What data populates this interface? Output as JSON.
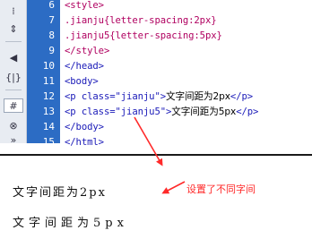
{
  "toolbar": {
    "icons": [
      "format-icon",
      "collapse-icon",
      "select-tag-icon",
      "braces-icon",
      "hash-icon",
      "comment-icon",
      "more-icon"
    ],
    "glyphs": [
      "⁞",
      "⇕",
      "◀",
      "{|}",
      "#",
      "⊗",
      "»"
    ]
  },
  "code_lines": [
    {
      "num": "6",
      "text": "<style>"
    },
    {
      "num": "7",
      "text": ".jianju{letter-spacing:2px}"
    },
    {
      "num": "8",
      "text": ".jianju5{letter-spacing:5px}"
    },
    {
      "num": "9",
      "text": "</style>"
    },
    {
      "num": "10",
      "text": "</head>"
    },
    {
      "num": "11",
      "text": "<body>"
    },
    {
      "num": "12",
      "text_a": "<p class=\"jianju\">",
      "text_b": "文字间距为2px",
      "text_c": "</p>"
    },
    {
      "num": "13",
      "text_a": "<p class=\"jianju5\">",
      "text_b": "文字间距为5px",
      "text_c": "</p>"
    },
    {
      "num": "14",
      "text": "</body>"
    },
    {
      "num": "15",
      "text": "</html>"
    }
  ],
  "preview": {
    "line1": "文字间距为2px",
    "line2": "文字间距为5px"
  },
  "annotation": "设置了不同字间",
  "colors": {
    "gutter": "#2c6cc4",
    "tag": "#b00060",
    "annotation": "#ff2a2a"
  }
}
